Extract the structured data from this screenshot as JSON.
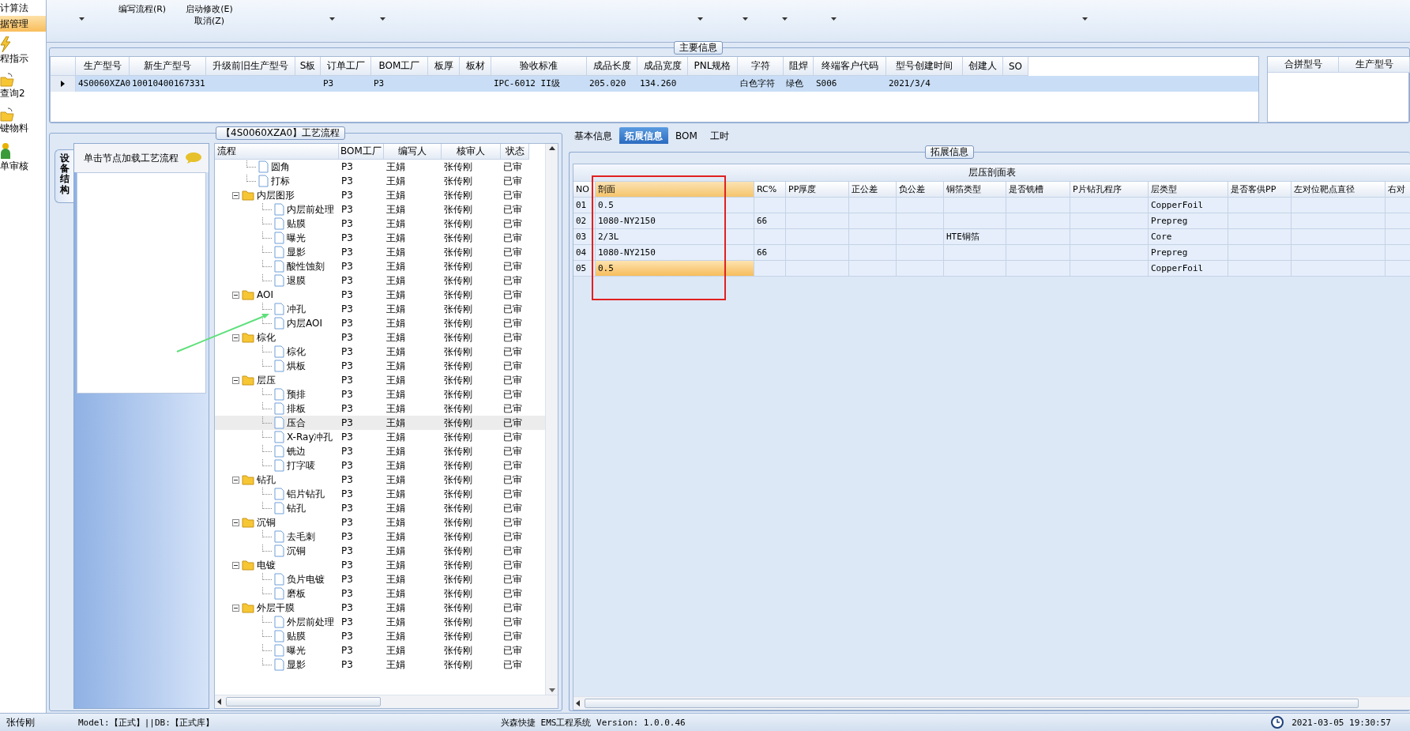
{
  "toolbar": {
    "groups": [
      {
        "kind": "dropdown"
      },
      {
        "kind": "command",
        "labels": [
          "编写流程(R)"
        ]
      },
      {
        "kind": "command",
        "labels": [
          "启动修改(E)",
          "取消(Z)"
        ]
      },
      {
        "kind": "dropdown"
      },
      {
        "kind": "dropdown"
      },
      {
        "kind": "dropdown"
      },
      {
        "kind": "dropdown"
      },
      {
        "kind": "dropdown"
      },
      {
        "kind": "dropdown"
      },
      {
        "kind": "dropdown"
      }
    ]
  },
  "sidebar": {
    "items": [
      {
        "kind": "text",
        "label": "计算法",
        "selected": false
      },
      {
        "kind": "text",
        "label": "据管理",
        "selected": true
      },
      {
        "kind": "bolt",
        "label": "程指示",
        "selected": false
      },
      {
        "kind": "folder",
        "label": "查询2",
        "selected": false
      },
      {
        "kind": "folder",
        "label": "键物料",
        "selected": false
      },
      {
        "kind": "person",
        "label": "单审核",
        "selected": false
      }
    ]
  },
  "main_info": {
    "title": "主要信息",
    "columns": [
      "生产型号",
      "新生产型号",
      "升级前旧生产型号",
      "S板",
      "订单工厂",
      "BOM工厂",
      "板厚",
      "板材",
      "验收标准",
      "成品长度",
      "成品宽度",
      "PNL规格",
      "字符",
      "阻焊",
      "终端客户代码",
      "型号创建时间",
      "创建人",
      "SO"
    ],
    "rows": [
      {
        "selected": true,
        "cells": [
          "4S0060XZA0",
          "10010400167331",
          null,
          null,
          "P3",
          "P3",
          null,
          null,
          "IPC-6012 II级",
          "205.020",
          "134.260",
          null,
          "白色字符",
          "绿色",
          "S006",
          "2021/3/4",
          null,
          null
        ]
      }
    ],
    "side_columns": [
      "合拼型号",
      "生产型号"
    ]
  },
  "process_panel": {
    "title": "【4S0060XZA0】工艺流程",
    "side_tab": "设备结构",
    "hint": "单击节点加载工艺流程",
    "tree": {
      "columns": [
        "流程",
        "BOM工厂",
        "编写人",
        "核审人",
        "状态"
      ],
      "rows": [
        {
          "kind": "file",
          "label": "圆角",
          "bom_factory": "P3",
          "writer": "王娟",
          "reviewer": "张传刚",
          "status": "已审",
          "selected": false
        },
        {
          "kind": "file",
          "label": "打标",
          "bom_factory": "P3",
          "writer": "王娟",
          "reviewer": "张传刚",
          "status": "已审",
          "selected": false
        },
        {
          "kind": "folder",
          "label": "内层图形",
          "bom_factory": "P3",
          "writer": "王娟",
          "reviewer": "张传刚",
          "status": "已审",
          "selected": false,
          "expanded": true,
          "children": [
            {
              "kind": "file",
              "label": "内层前处理",
              "bom_factory": "P3",
              "writer": "王娟",
              "reviewer": "张传刚",
              "status": "已审",
              "selected": false
            },
            {
              "kind": "file",
              "label": "贴膜",
              "bom_factory": "P3",
              "writer": "王娟",
              "reviewer": "张传刚",
              "status": "已审",
              "selected": false
            },
            {
              "kind": "file",
              "label": "曝光",
              "bom_factory": "P3",
              "writer": "王娟",
              "reviewer": "张传刚",
              "status": "已审",
              "selected": false
            },
            {
              "kind": "file",
              "label": "显影",
              "bom_factory": "P3",
              "writer": "王娟",
              "reviewer": "张传刚",
              "status": "已审",
              "selected": false
            },
            {
              "kind": "file",
              "label": "酸性蚀刻",
              "bom_factory": "P3",
              "writer": "王娟",
              "reviewer": "张传刚",
              "status": "已审",
              "selected": false
            },
            {
              "kind": "file",
              "label": "退膜",
              "bom_factory": "P3",
              "writer": "王娟",
              "reviewer": "张传刚",
              "status": "已审",
              "selected": false
            }
          ]
        },
        {
          "kind": "folder",
          "label": "AOI",
          "bom_factory": "P3",
          "writer": "王娟",
          "reviewer": "张传刚",
          "status": "已审",
          "selected": false,
          "expanded": true,
          "children": [
            {
              "kind": "file",
              "label": "冲孔",
              "bom_factory": "P3",
              "writer": "王娟",
              "reviewer": "张传刚",
              "status": "已审",
              "selected": false
            },
            {
              "kind": "file",
              "label": "内层AOI",
              "bom_factory": "P3",
              "writer": "王娟",
              "reviewer": "张传刚",
              "status": "已审",
              "selected": false
            }
          ]
        },
        {
          "kind": "folder",
          "label": "棕化",
          "bom_factory": "P3",
          "writer": "王娟",
          "reviewer": "张传刚",
          "status": "已审",
          "selected": false,
          "expanded": true,
          "children": [
            {
              "kind": "file",
              "label": "棕化",
              "bom_factory": "P3",
              "writer": "王娟",
              "reviewer": "张传刚",
              "status": "已审",
              "selected": false
            },
            {
              "kind": "file",
              "label": "烘板",
              "bom_factory": "P3",
              "writer": "王娟",
              "reviewer": "张传刚",
              "status": "已审",
              "selected": false
            }
          ]
        },
        {
          "kind": "folder",
          "label": "层压",
          "bom_factory": "P3",
          "writer": "王娟",
          "reviewer": "张传刚",
          "status": "已审",
          "selected": false,
          "expanded": true,
          "children": [
            {
              "kind": "file",
              "label": "预排",
              "bom_factory": "P3",
              "writer": "王娟",
              "reviewer": "张传刚",
              "status": "已审",
              "selected": false
            },
            {
              "kind": "file",
              "label": "排板",
              "bom_factory": "P3",
              "writer": "王娟",
              "reviewer": "张传刚",
              "status": "已审",
              "selected": false
            },
            {
              "kind": "file",
              "label": "压合",
              "bom_factory": "P3",
              "writer": "王娟",
              "reviewer": "张传刚",
              "status": "已审",
              "selected": true
            },
            {
              "kind": "file",
              "label": "X-Ray冲孔",
              "bom_factory": "P3",
              "writer": "王娟",
              "reviewer": "张传刚",
              "status": "已审",
              "selected": false
            },
            {
              "kind": "file",
              "label": "铣边",
              "bom_factory": "P3",
              "writer": "王娟",
              "reviewer": "张传刚",
              "status": "已审",
              "selected": false
            },
            {
              "kind": "file",
              "label": "打字唛",
              "bom_factory": "P3",
              "writer": "王娟",
              "reviewer": "张传刚",
              "status": "已审",
              "selected": false
            }
          ]
        },
        {
          "kind": "folder",
          "label": "钻孔",
          "bom_factory": "P3",
          "writer": "王娟",
          "reviewer": "张传刚",
          "status": "已审",
          "selected": false,
          "expanded": true,
          "children": [
            {
              "kind": "file",
              "label": "铝片钻孔",
              "bom_factory": "P3",
              "writer": "王娟",
              "reviewer": "张传刚",
              "status": "已审",
              "selected": false
            },
            {
              "kind": "file",
              "label": "钻孔",
              "bom_factory": "P3",
              "writer": "王娟",
              "reviewer": "张传刚",
              "status": "已审",
              "selected": false
            }
          ]
        },
        {
          "kind": "folder",
          "label": "沉铜",
          "bom_factory": "P3",
          "writer": "王娟",
          "reviewer": "张传刚",
          "status": "已审",
          "selected": false,
          "expanded": true,
          "children": [
            {
              "kind": "file",
              "label": "去毛刺",
              "bom_factory": "P3",
              "writer": "王娟",
              "reviewer": "张传刚",
              "status": "已审",
              "selected": false
            },
            {
              "kind": "file",
              "label": "沉铜",
              "bom_factory": "P3",
              "writer": "王娟",
              "reviewer": "张传刚",
              "status": "已审",
              "selected": false
            }
          ]
        },
        {
          "kind": "folder",
          "label": "电镀",
          "bom_factory": "P3",
          "writer": "王娟",
          "reviewer": "张传刚",
          "status": "已审",
          "selected": false,
          "expanded": true,
          "children": [
            {
              "kind": "file",
              "label": "负片电镀",
              "bom_factory": "P3",
              "writer": "王娟",
              "reviewer": "张传刚",
              "status": "已审",
              "selected": false
            },
            {
              "kind": "file",
              "label": "磨板",
              "bom_factory": "P3",
              "writer": "王娟",
              "reviewer": "张传刚",
              "status": "已审",
              "selected": false
            }
          ]
        },
        {
          "kind": "folder",
          "label": "外层干膜",
          "bom_factory": "P3",
          "writer": "王娟",
          "reviewer": "张传刚",
          "status": "已审",
          "selected": false,
          "expanded": true,
          "children": [
            {
              "kind": "file",
              "label": "外层前处理",
              "bom_factory": "P3",
              "writer": "王娟",
              "reviewer": "张传刚",
              "status": "已审",
              "selected": false
            },
            {
              "kind": "file",
              "label": "贴膜",
              "bom_factory": "P3",
              "writer": "王娟",
              "reviewer": "张传刚",
              "status": "已审",
              "selected": false
            },
            {
              "kind": "file",
              "label": "曝光",
              "bom_factory": "P3",
              "writer": "王娟",
              "reviewer": "张传刚",
              "status": "已审",
              "selected": false
            },
            {
              "kind": "file",
              "label": "显影",
              "bom_factory": "P3",
              "writer": "王娟",
              "reviewer": "张传刚",
              "status": "已审",
              "selected": false
            }
          ]
        }
      ]
    }
  },
  "detail_panel": {
    "tabs": [
      {
        "label": "基本信息",
        "selected": false
      },
      {
        "label": "拓展信息",
        "selected": true
      },
      {
        "label": "BOM",
        "selected": false
      },
      {
        "label": "工时",
        "selected": false
      }
    ],
    "group_title": "拓展信息",
    "table": {
      "title": "层压剖面表",
      "columns": [
        "NO",
        "剖面",
        "RC%",
        "PP厚度",
        "正公差",
        "负公差",
        "铜箔类型",
        "是否铣槽",
        "P片钻孔程序",
        "层类型",
        "是否客供PP",
        "左对位靶点直径",
        "右对"
      ],
      "rows": [
        {
          "selected": false,
          "cells": [
            "01",
            "0.5",
            null,
            null,
            null,
            null,
            null,
            null,
            null,
            "CopperFoil",
            null,
            null,
            null
          ]
        },
        {
          "selected": false,
          "cells": [
            "02",
            "1080-NY2150",
            "66",
            null,
            null,
            null,
            null,
            null,
            null,
            "Prepreg",
            null,
            null,
            null
          ]
        },
        {
          "selected": false,
          "cells": [
            "03",
            "2/3L",
            null,
            null,
            null,
            null,
            "HTE铜箔",
            null,
            null,
            "Core",
            null,
            null,
            null
          ]
        },
        {
          "selected": false,
          "cells": [
            "04",
            "1080-NY2150",
            "66",
            null,
            null,
            null,
            null,
            null,
            null,
            "Prepreg",
            null,
            null,
            null
          ]
        },
        {
          "selected": true,
          "cells": [
            "05",
            "0.5",
            null,
            null,
            null,
            null,
            null,
            null,
            null,
            "CopperFoil",
            null,
            null,
            null
          ]
        }
      ]
    }
  },
  "status_bar": {
    "user": "张传刚",
    "environment": "Model:【正式】||DB:【正式库】",
    "application": "兴森快捷 EMS工程系统 Version: 1.0.0.46",
    "time": "2021-03-05 19:30:57"
  }
}
